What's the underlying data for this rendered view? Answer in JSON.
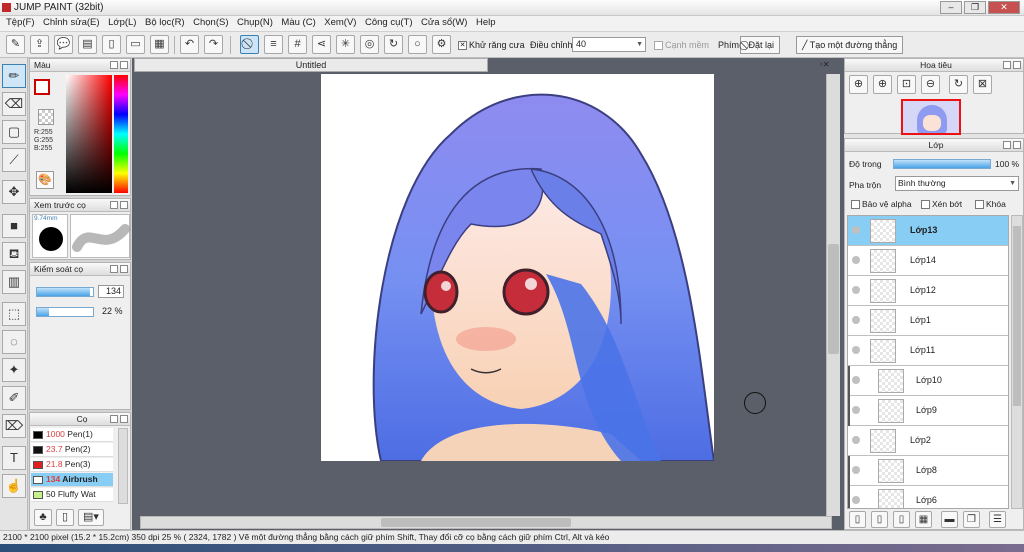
{
  "window": {
    "title": "JUMP PAINT (32bit)"
  },
  "menu": [
    "Tệp(F)",
    "Chỉnh sửa(E)",
    "Lớp(L)",
    "Bộ lọc(R)",
    "Chọn(S)",
    "Chụp(N)",
    "Màu (C)",
    "Xem(V)",
    "Công cụ(T)",
    "Cửa sổ(W)",
    "Help"
  ],
  "toolbar": {
    "antialias_label": "Khử răng cưa",
    "adjust_label": "Điều chỉnh",
    "adjust_value": "40",
    "edge_label": "Cạnh mềm",
    "key_label": "Phím",
    "reset_label": "Đặt lại",
    "straight_label": "Tạo một đường thẳng"
  },
  "color_panel": {
    "title": "Màu",
    "r": "R:255",
    "g": "G:255",
    "b": "B:255"
  },
  "brush_preview": {
    "title": "Xem trước cọ",
    "size": "9.74mm"
  },
  "brush_control": {
    "title": "Kiểm soát cọ",
    "size_value": "134",
    "opacity_value": "22 %",
    "size_fraction": 0.95,
    "opacity_fraction": 0.22
  },
  "brushes": {
    "title": "Cọ",
    "items": [
      {
        "size": "1000",
        "name": "Pen(1)",
        "color": "#000000",
        "size_color": "#d94040"
      },
      {
        "size": "23.7",
        "name": "Pen(2)",
        "color": "#111111",
        "size_color": "#d94040"
      },
      {
        "size": "21.8",
        "name": "Pen(3)",
        "color": "#e02020",
        "size_color": "#d94040"
      },
      {
        "size": "134",
        "name": "Airbrush",
        "color": "#ffffff",
        "size_color": "#d94040",
        "selected": true
      },
      {
        "size": "50",
        "name": "Fluffy Wat",
        "color": "#c6f08a",
        "size_color": "#222222"
      }
    ]
  },
  "document": {
    "tab": "Untitled"
  },
  "navigator": {
    "title": "Hoa tiêu"
  },
  "layers": {
    "title": "Lớp",
    "opacity_label": "Độ trong",
    "opacity_value": "100 %",
    "blend_label": "Pha trộn",
    "blend_value": "Bình thường",
    "protect_alpha": "Bảo vệ alpha",
    "clip": "Xén bớt",
    "lock": "Khóa",
    "items": [
      {
        "name": "Lớp13",
        "active": true,
        "indent": false
      },
      {
        "name": "Lớp14",
        "indent": false
      },
      {
        "name": "Lớp12",
        "indent": false
      },
      {
        "name": "Lớp1",
        "indent": false
      },
      {
        "name": "Lớp11",
        "indent": false
      },
      {
        "name": "Lớp10",
        "indent": true
      },
      {
        "name": "Lớp9",
        "indent": true
      },
      {
        "name": "Lớp2",
        "indent": false
      },
      {
        "name": "Lớp8",
        "indent": true
      },
      {
        "name": "Lớp6",
        "indent": true
      }
    ]
  },
  "status": {
    "text": "2100 * 2100 pixel   (15.2 * 15.2cm)   350 dpi   25 %   ( 2324, 1782 )   Vẽ một đường thẳng bằng cách giữ phím Shift, Thay đổi cỡ cọ bằng cách giữ phím Ctrl, Alt và kéo"
  },
  "colors": {
    "accent": "#3c7fb1",
    "layer_active": "#87cdf4",
    "canvas_bg": "#5b5f69"
  }
}
